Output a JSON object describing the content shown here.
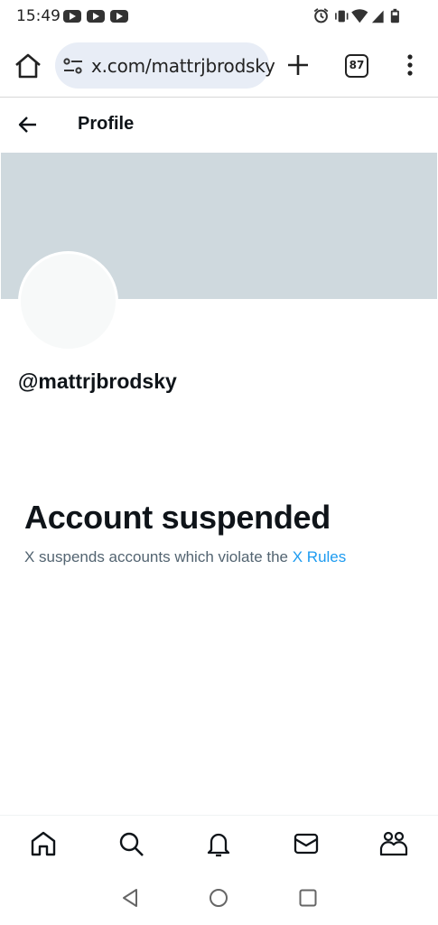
{
  "status_bar": {
    "time": "15:49",
    "notification_icons": [
      "youtube-icon",
      "youtube-icon",
      "youtube-icon"
    ],
    "system_icons": [
      "alarm-icon",
      "vibrate-icon",
      "wifi-icon",
      "cell-signal-icon",
      "battery-icon"
    ]
  },
  "browser": {
    "url": "x.com/mattrjbrodsky",
    "tab_count": "87",
    "icons": [
      "home-icon",
      "site-settings-icon",
      "new-tab-icon",
      "tab-switcher-icon",
      "more-vert-icon"
    ]
  },
  "header": {
    "title": "Profile",
    "back_icon": "arrow-left-icon"
  },
  "profile": {
    "handle": "@mattrjbrodsky",
    "banner_color": "#cfd9de",
    "avatar_color": "#f7f9f9"
  },
  "suspension": {
    "title": "Account suspended",
    "description": "X suspends accounts which violate the ",
    "rules_link": "X Rules",
    "link_color": "#1d9bf0"
  },
  "bottom_nav": {
    "items": [
      {
        "icon": "home-icon"
      },
      {
        "icon": "search-icon"
      },
      {
        "icon": "notifications-icon"
      },
      {
        "icon": "messages-icon"
      },
      {
        "icon": "communities-icon"
      }
    ]
  },
  "android_nav": {
    "items": [
      "back-triangle-icon",
      "home-circle-icon",
      "recents-square-icon"
    ]
  }
}
